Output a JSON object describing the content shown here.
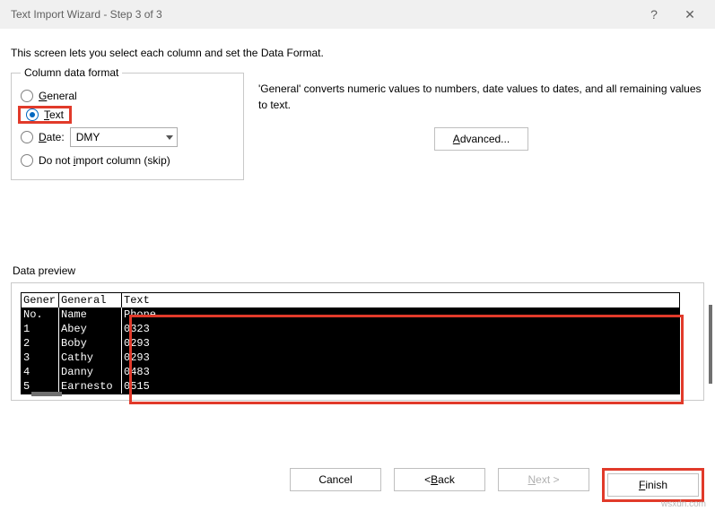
{
  "title": "Text Import Wizard - Step 3 of 3",
  "intro": "This screen lets you select each column and set the Data Format.",
  "column_format": {
    "legend": "Column data format",
    "general": "General",
    "text": "Text",
    "date_label": "Date:",
    "date_value": "DMY",
    "skip": "Do not import column (skip)"
  },
  "description": "'General' converts numeric values to numbers, date values to dates, and all remaining values to text.",
  "advanced_label": "Advanced...",
  "preview_legend": "Data preview",
  "headers": {
    "c0": "Gener",
    "c1": "General",
    "c2": "Text"
  },
  "rows": [
    {
      "c0": "No.",
      "c1": "Name",
      "c2": "Phone"
    },
    {
      "c0": "1",
      "c1": "Abey",
      "c2": "0323"
    },
    {
      "c0": "2",
      "c1": "Boby",
      "c2": "0293"
    },
    {
      "c0": "3",
      "c1": "Cathy",
      "c2": "0293"
    },
    {
      "c0": "4",
      "c1": "Danny",
      "c2": "0483"
    },
    {
      "c0": "5",
      "c1": "Earnesto",
      "c2": "0515"
    }
  ],
  "buttons": {
    "cancel": "Cancel",
    "back": "< Back",
    "next": "Next >",
    "finish": "Finish"
  },
  "watermark": "wsxdn.com"
}
